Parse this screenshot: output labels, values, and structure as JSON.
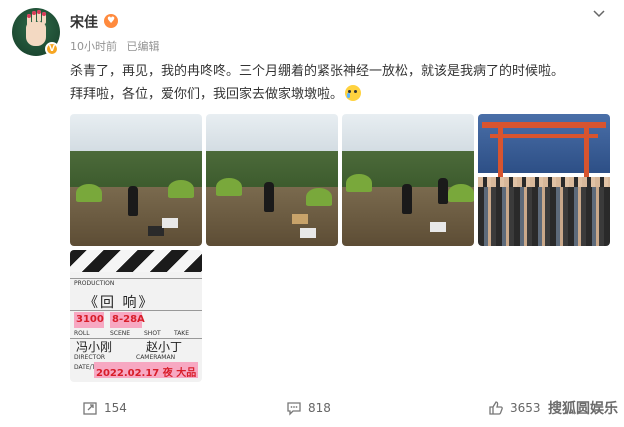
{
  "post": {
    "username": "宋佳",
    "time": "10小时前",
    "edited": "已编辑",
    "text_line1": "杀青了，再见，我的冉咚咚。三个月绷着的紧张神经一放松，就该是我病了的时候啦。",
    "text_line2": "拜拜啦，各位，爱你们，我回家去做家墩墩啦。"
  },
  "slate": {
    "title": "《回  响》",
    "label_production": "PRODUCTION",
    "label_roll": "ROLL",
    "label_scene": "SCENE",
    "label_take": "TAKE",
    "label_shot": "SHOT",
    "roll_value": "3100",
    "scene_value": "8-28A",
    "director": "冯小刚",
    "camera": "赵小丁",
    "label_director": "DIRECTOR",
    "label_camera": "CAMERAMAN",
    "label_date": "DATE/TIME",
    "date": "2022.02.17 夜 大品"
  },
  "actions": {
    "repost_count": "154",
    "comment_count": "818",
    "like_count": "3653"
  },
  "watermark": "搜狐圆娱乐",
  "icons": {
    "chevron": "chevron-down-icon",
    "repost": "repost-icon",
    "comment": "comment-icon",
    "like": "thumbs-up-icon",
    "verified": "verified-badge-icon",
    "emoji": "crying-face-icon"
  },
  "colors": {
    "username": "#333333",
    "meta": "#939393",
    "verified": "#f6a623",
    "slate_red": "#d81e2a"
  }
}
